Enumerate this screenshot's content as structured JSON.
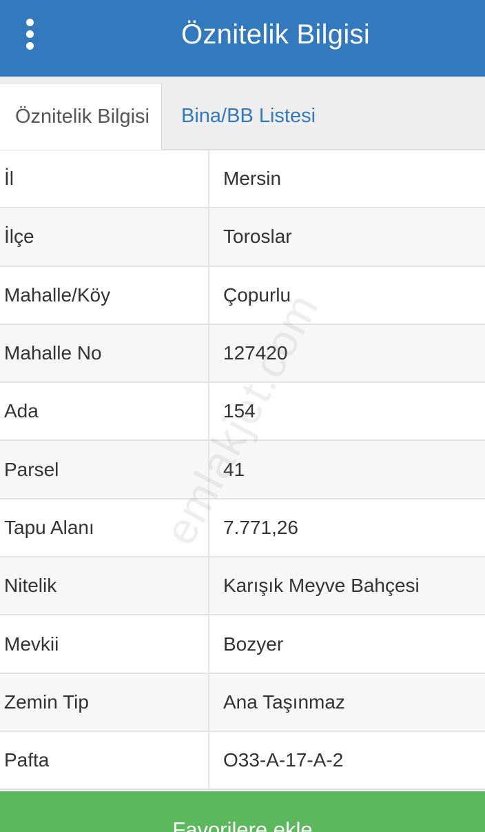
{
  "header": {
    "title": "Öznitelik Bilgisi",
    "menu_icon": "more-vertical-icon"
  },
  "tabs": [
    {
      "label": "Öznitelik Bilgisi",
      "active": true
    },
    {
      "label": "Bina/BB Listesi",
      "active": false
    }
  ],
  "attributes": [
    {
      "label": "İl",
      "value": "Mersin"
    },
    {
      "label": "İlçe",
      "value": "Toroslar"
    },
    {
      "label": "Mahalle/Köy",
      "value": "Çopurlu"
    },
    {
      "label": "Mahalle No",
      "value": "127420"
    },
    {
      "label": "Ada",
      "value": "154"
    },
    {
      "label": "Parsel",
      "value": "41"
    },
    {
      "label": "Tapu Alanı",
      "value": "7.771,26"
    },
    {
      "label": "Nitelik",
      "value": "Karışık Meyve Bahçesi"
    },
    {
      "label": "Mevkii",
      "value": "Bozyer"
    },
    {
      "label": "Zemin Tip",
      "value": "Ana Taşınmaz"
    },
    {
      "label": "Pafta",
      "value": "O33-A-17-A-2"
    }
  ],
  "watermark": "emlakjet.com",
  "footer": {
    "button_label": "Favorilere ekle"
  },
  "colors": {
    "header_bg": "#3379bd",
    "tab_link": "#3379bd",
    "button_bg": "#5cb85c"
  }
}
